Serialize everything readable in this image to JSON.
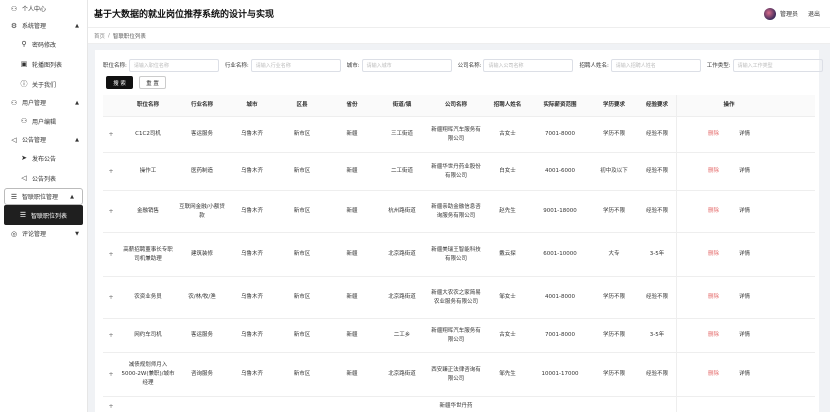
{
  "header": {
    "title": "基于大数据的就业岗位推荐系统的设计与实现",
    "user": "管理员",
    "logout": "退出"
  },
  "breadcrumb": {
    "home": "首页",
    "sep": "/",
    "current": "智联职位列表"
  },
  "sidebar": {
    "items": [
      {
        "label": "个人中心",
        "icon": "user-icon",
        "kind": "top"
      },
      {
        "label": "系统管理",
        "icon": "gear-icon",
        "kind": "group",
        "chev": "▲"
      },
      {
        "label": "密码修改",
        "icon": "key-icon",
        "kind": "sub"
      },
      {
        "label": "轮播图列表",
        "icon": "image-icon",
        "kind": "sub"
      },
      {
        "label": "关于我们",
        "icon": "info-icon",
        "kind": "sub"
      },
      {
        "label": "用户管理",
        "icon": "users-icon",
        "kind": "group",
        "chev": "▲"
      },
      {
        "label": "用户编辑",
        "icon": "user-icon",
        "kind": "sub"
      },
      {
        "label": "公告管理",
        "icon": "megaphone-icon",
        "kind": "group",
        "chev": "▲"
      },
      {
        "label": "发布公告",
        "icon": "send-icon",
        "kind": "sub"
      },
      {
        "label": "公告列表",
        "icon": "megaphone-icon",
        "kind": "sub"
      },
      {
        "label": "智联职位管理",
        "icon": "menu-icon",
        "kind": "group-active",
        "chev": "▲"
      },
      {
        "label": "智联职位列表",
        "icon": "list-icon",
        "kind": "active"
      },
      {
        "label": "评论管理",
        "icon": "comment-icon",
        "kind": "group",
        "chev": "▼"
      }
    ]
  },
  "filters": [
    {
      "label": "职位名称:",
      "placeholder": "请输入职位名称"
    },
    {
      "label": "行业名称:",
      "placeholder": "请输入行业名称"
    },
    {
      "label": "城市:",
      "placeholder": "请输入城市"
    },
    {
      "label": "公司名称:",
      "placeholder": "请输入公司名称"
    },
    {
      "label": "招聘人姓名:",
      "placeholder": "请输入招聘人姓名"
    },
    {
      "label": "工作类型:",
      "placeholder": "请输入工作类型"
    }
  ],
  "buttons": {
    "search": "搜 索",
    "reset": "重 置"
  },
  "table": {
    "columns": [
      "",
      "职位名称",
      "行业名称",
      "城市",
      "区县",
      "省份",
      "街道/镇",
      "公司名称",
      "招聘人姓名",
      "实际薪资范围",
      "学历要求",
      "经验要求",
      "操作"
    ],
    "delete_label": "删除",
    "detail_label": "详情",
    "expand_symbol": "+",
    "rows": [
      {
        "h": 36,
        "cells": [
          "C1C2司机",
          "客运服务",
          "乌鲁木齐",
          "新市区",
          "新疆",
          "三工街道",
          "新疆翔晖汽车服务有限公司",
          "古女士",
          "7001-8000",
          "学历不限",
          "经验不限"
        ]
      },
      {
        "h": 38,
        "cells": [
          "操作工",
          "医药制造",
          "乌鲁木齐",
          "新市区",
          "新疆",
          "二工街道",
          "新疆华世丹药业股份有限公司",
          "白女士",
          "4001-6000",
          "初中及以下",
          "经验不限"
        ]
      },
      {
        "h": 42,
        "cells": [
          "金融销售",
          "互联网金融/小额贷款",
          "乌鲁木齐",
          "新市区",
          "新疆",
          "杭州路街道",
          "新疆亲助金融信息咨询服务有限公司",
          "赵先生",
          "9001-18000",
          "学历不限",
          "经验不限"
        ]
      },
      {
        "h": 44,
        "cells": [
          "高薪招聘董事长专职司机兼助理",
          "建筑装修",
          "乌鲁木齐",
          "新市区",
          "新疆",
          "北京路街道",
          "新疆美瑞王智能科技有限公司",
          "戴云探",
          "6001-10000",
          "大专",
          "3-5年"
        ]
      },
      {
        "h": 42,
        "cells": [
          "农资业务员",
          "农/林/牧/渔",
          "乌鲁木齐",
          "新市区",
          "新疆",
          "北京路街道",
          "新疆大农农之家简易农业服务有限公司",
          "邹女士",
          "4001-8000",
          "学历不限",
          "经验不限"
        ]
      },
      {
        "h": 34,
        "cells": [
          "网约车司机",
          "客运服务",
          "乌鲁木齐",
          "新市区",
          "新疆",
          "二工乡",
          "新疆翔晖汽车服务有限公司",
          "古女士",
          "7001-8000",
          "学历不限",
          "3-5年"
        ]
      },
      {
        "h": 44,
        "cells": [
          "减债规划师月入5000-2W(兼职)/城市经理",
          "咨询服务",
          "乌鲁木齐",
          "新市区",
          "新疆",
          "北京路街道",
          "西安臻正法律咨询有限公司",
          "邹先生",
          "10001-17000",
          "学历不限",
          "经验不限"
        ]
      },
      {
        "h": 20,
        "cells": [
          "",
          "",
          "",
          "",
          "",
          "",
          "新疆华世丹药",
          "",
          "",
          "",
          ""
        ]
      }
    ]
  }
}
